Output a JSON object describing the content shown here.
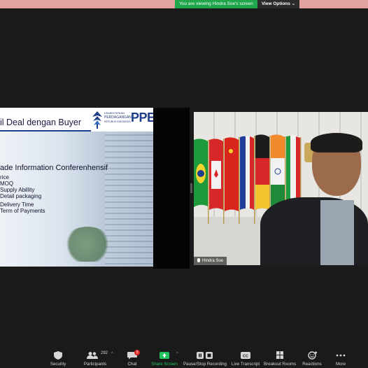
{
  "top": {
    "viewing_text": "You are viewing Hindra Soe's screen",
    "view_options": "View Options ⌄",
    "bar_color": "#e0a3a0",
    "viewing_color": "#1fa64a"
  },
  "slide": {
    "title": "il Deal dengan Buyer",
    "logo_line1": "KEMENTERIAN",
    "logo_line2": "PERDAGANGAN",
    "logo_line3": "REPUBLIK INDONESIA",
    "logo_text": "PPE",
    "heading": "ade Information Conferenhensif",
    "bullets": [
      "rice",
      "MOQ",
      "Supply Abillity",
      "Detail packaging",
      "Delivery Time",
      "Term of Payments"
    ]
  },
  "video": {
    "participant_name": "Hindra Soe"
  },
  "toolbar": {
    "security": "Security",
    "participants": "Participants",
    "participants_count": "292",
    "chat": "Chat",
    "chat_badge": "3",
    "share_screen": "Share Screen",
    "pause_stop": "Pause/Stop Recording",
    "live_transcript": "Live Transcript",
    "breakout_rooms": "Breakout Rooms",
    "reactions": "Reactions",
    "more": "More",
    "share_color": "#22c35e"
  }
}
